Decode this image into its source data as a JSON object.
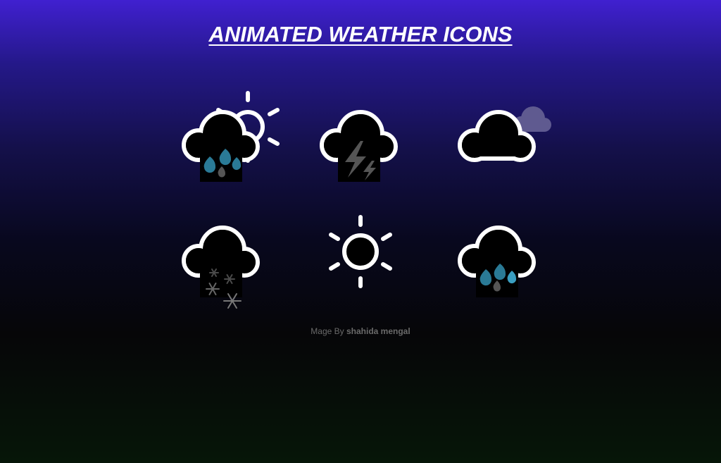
{
  "page": {
    "title": "ANIMATED WEATHER ICONS"
  },
  "icons": [
    {
      "name": "sun-shower-icon",
      "row": 1,
      "col": 1
    },
    {
      "name": "thunder-storm-icon",
      "row": 1,
      "col": 2
    },
    {
      "name": "cloudy-icon",
      "row": 1,
      "col": 3
    },
    {
      "name": "flurries-icon",
      "row": 2,
      "col": 1
    },
    {
      "name": "sunny-icon",
      "row": 2,
      "col": 2
    },
    {
      "name": "rainy-icon",
      "row": 2,
      "col": 3
    }
  ],
  "credit": {
    "prefix": "Mage By",
    "author": "shahida mengal"
  },
  "colors": {
    "raindrop": "#2a7a96",
    "lightning": "#555555",
    "snowflake": "#555555",
    "back_cloud": "#5f5a90"
  }
}
